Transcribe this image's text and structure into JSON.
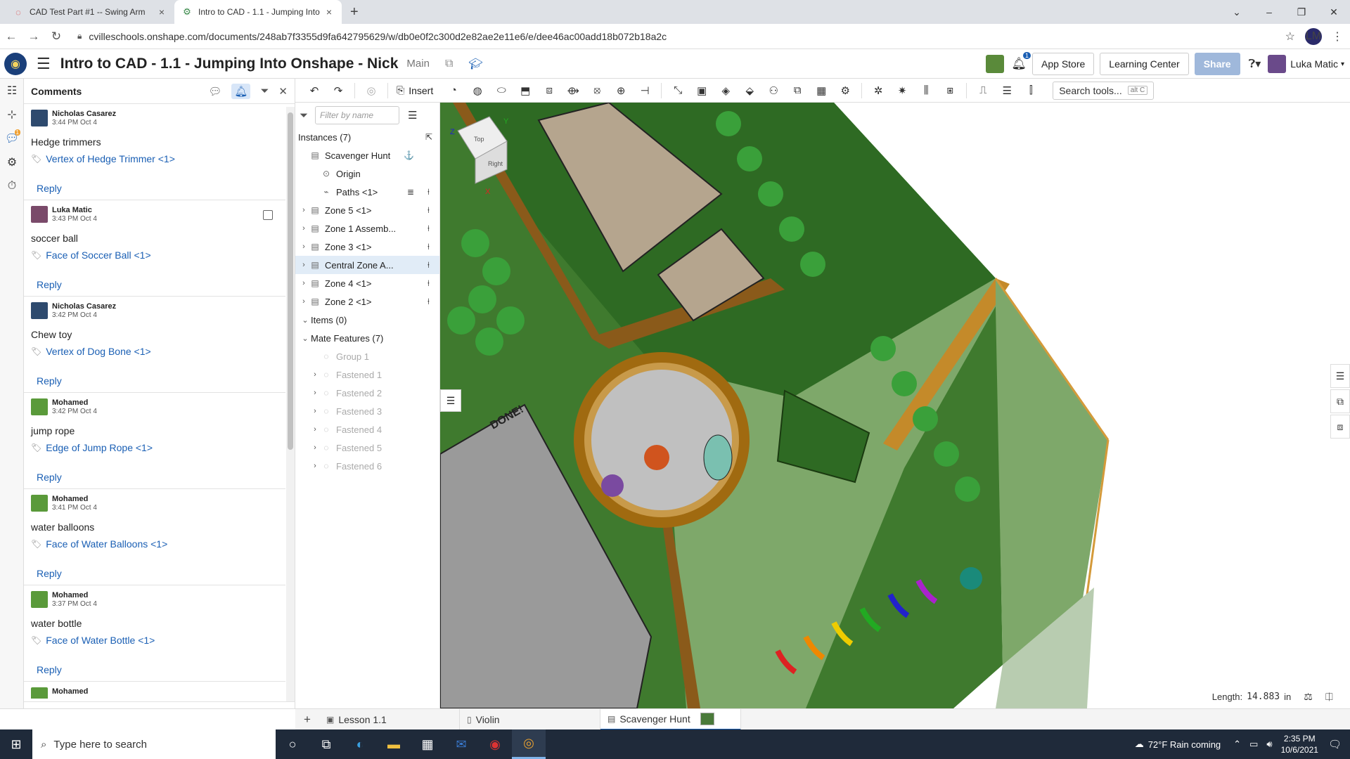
{
  "browser": {
    "tabs": [
      {
        "title": "CAD Test Part #1 -- Swing Arm",
        "icon": "onshape-cad-icon"
      },
      {
        "title": "Intro to CAD - 1.1 - Jumping Into",
        "icon": "onshape-doc-icon"
      }
    ],
    "url": "cvilleschools.onshape.com/documents/248ab7f3355d9fa642795629/w/db0e0f2c300d2e82ae2e11e6/e/dee46ac00add18b072b18a2c",
    "profile_initials": "LM"
  },
  "header": {
    "title": "Intro to CAD - 1.1 - Jumping Into Onshape - Nick",
    "branch": "Main",
    "app_store": "App Store",
    "learning_center": "Learning Center",
    "share": "Share",
    "notification_count": "1",
    "user_name": "Luka Matic"
  },
  "rail": {
    "comment_badge": "1"
  },
  "comments": {
    "title": "Comments",
    "reply_label": "Reply",
    "items": [
      {
        "author": "Nicholas Casarez",
        "time": "3:44 PM Oct 4",
        "text": "Hedge trimmers",
        "link": "Vertex of Hedge Trimmer <1>",
        "avatar_color": "#2e4a6e"
      },
      {
        "author": "Luka Matic",
        "time": "3:43 PM Oct 4",
        "text": "soccer ball",
        "link": "Face of Soccer Ball <1>",
        "avatar_color": "#7a4a6a"
      },
      {
        "author": "Nicholas Casarez",
        "time": "3:42 PM Oct 4",
        "text": "Chew toy",
        "link": "Vertex of Dog Bone <1>",
        "avatar_color": "#2e4a6e"
      },
      {
        "author": "Mohamed",
        "time": "3:42 PM Oct 4",
        "text": "jump rope",
        "link": "Edge of Jump Rope <1>",
        "avatar_color": "#5a9a3a"
      },
      {
        "author": "Mohamed",
        "time": "3:41 PM Oct 4",
        "text": "water balloons",
        "link": "Face of Water Balloons <1>",
        "avatar_color": "#5a9a3a"
      },
      {
        "author": "Mohamed",
        "time": "3:37 PM Oct 4",
        "text": "water bottle",
        "link": "Face of Water Bottle <1>",
        "avatar_color": "#5a9a3a"
      },
      {
        "author": "Mohamed",
        "time": "",
        "text": "",
        "link": "",
        "avatar_color": "#5a9a3a"
      }
    ]
  },
  "toolbar": {
    "insert_label": "Insert",
    "search_tools": "Search tools...",
    "search_shortcut": "alt C"
  },
  "instances": {
    "filter_placeholder": "Filter by name",
    "header": "Instances (7)",
    "rows": [
      {
        "label": "Scavenger Hunt",
        "chev": "",
        "icon": "▤",
        "right": "⚓",
        "dot": "",
        "indent": 0
      },
      {
        "label": "Origin",
        "chev": "",
        "icon": "⊙",
        "right": "",
        "dot": "",
        "indent": 1
      },
      {
        "label": "Paths <1>",
        "chev": "",
        "icon": "⌁",
        "right": "≣",
        "dot": "⍿",
        "indent": 1
      },
      {
        "label": "Zone 5 <1>",
        "chev": "›",
        "icon": "▤",
        "right": "",
        "dot": "⍿",
        "indent": 0
      },
      {
        "label": "Zone 1 Assemb...",
        "chev": "›",
        "icon": "▤",
        "right": "",
        "dot": "⍿",
        "indent": 0
      },
      {
        "label": "Zone 3 <1>",
        "chev": "›",
        "icon": "▤",
        "right": "",
        "dot": "⍿",
        "indent": 0
      },
      {
        "label": "Central Zone A...",
        "chev": "›",
        "icon": "▤",
        "right": "",
        "dot": "⍿",
        "indent": 0
      },
      {
        "label": "Zone 4 <1>",
        "chev": "›",
        "icon": "▤",
        "right": "",
        "dot": "⍿",
        "indent": 0
      },
      {
        "label": "Zone 2 <1>",
        "chev": "›",
        "icon": "▤",
        "right": "",
        "dot": "⍿",
        "indent": 0
      }
    ],
    "items_header": "Items (0)",
    "mates_header": "Mate Features (7)",
    "mates": [
      {
        "label": "Group 1",
        "chev": ""
      },
      {
        "label": "Fastened 1",
        "chev": "›"
      },
      {
        "label": "Fastened 2",
        "chev": "›"
      },
      {
        "label": "Fastened 3",
        "chev": "›"
      },
      {
        "label": "Fastened 4",
        "chev": "›"
      },
      {
        "label": "Fastened 5",
        "chev": "›"
      },
      {
        "label": "Fastened 6",
        "chev": "›"
      }
    ]
  },
  "viewport": {
    "done_text": "DONE!",
    "length_label": "Length:",
    "length_value": "14.883",
    "length_unit": "in",
    "viewcube": {
      "top": "Top",
      "right": "Right",
      "x": "X",
      "y": "Y",
      "z": "Z"
    }
  },
  "bottom_tabs": [
    {
      "label": "Lesson 1.1",
      "icon": "▣",
      "active": false
    },
    {
      "label": "Violin",
      "icon": "▯",
      "active": false
    },
    {
      "label": "Scavenger Hunt",
      "icon": "▤",
      "active": true
    }
  ],
  "taskbar": {
    "search_placeholder": "Type here to search",
    "weather": "72°F  Rain coming",
    "time": "2:35 PM",
    "date": "10/6/2021",
    "notification_count": "1"
  }
}
